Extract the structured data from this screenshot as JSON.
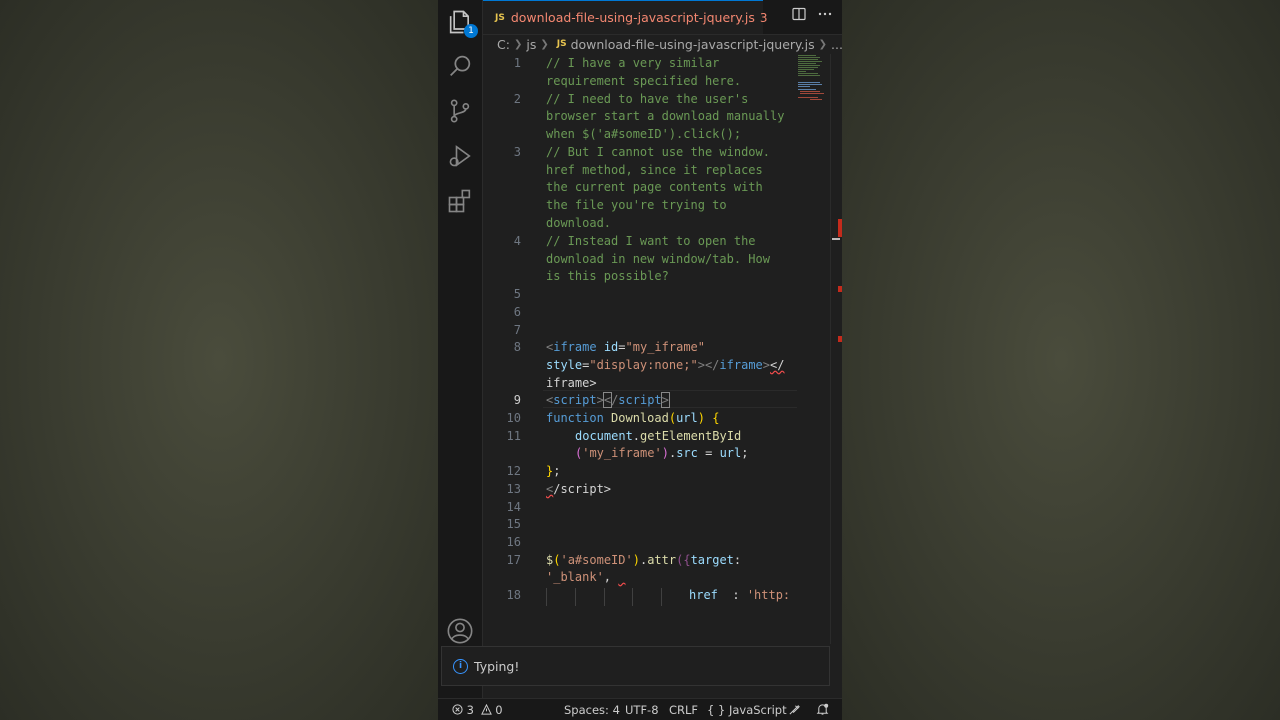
{
  "tab": {
    "lang_tag": "JS",
    "title": "download-file-using-javascript-jquery.js",
    "problems": "3",
    "split_icon": "split-editor-icon",
    "more_icon": "more-actions-icon"
  },
  "breadcrumb": {
    "drive": "C:",
    "folder": "js",
    "lang_tag": "JS",
    "file": "download-file-using-javascript-jquery.js",
    "more": "..."
  },
  "activity": {
    "explorer_badge": "1"
  },
  "editor": {
    "lines": [
      {
        "n": "1"
      },
      {
        "n": "2"
      },
      {
        "n": "3"
      },
      {
        "n": "4"
      },
      {
        "n": "5"
      },
      {
        "n": "6"
      },
      {
        "n": "7"
      },
      {
        "n": "8"
      },
      {
        "n": "9"
      },
      {
        "n": "10"
      },
      {
        "n": "11"
      },
      {
        "n": "12"
      },
      {
        "n": "13"
      },
      {
        "n": "14"
      },
      {
        "n": "15"
      },
      {
        "n": "16"
      },
      {
        "n": "17"
      },
      {
        "n": "18"
      }
    ],
    "code": {
      "l1a": "// I have a very similar",
      "l1b": "requirement specified here.",
      "l2a": "// I need to have the user's",
      "l2b": "browser start a download manually",
      "l2c": "when $('a#someID').click();",
      "l3a": "// But I cannot use the window.",
      "l3b": "href method, since it replaces",
      "l3c": "the current page contents with",
      "l3d": "the file you're trying to",
      "l3e": "download.",
      "l4a": "// Instead I want to open the",
      "l4b": "download in new window/tab. How",
      "l4c": "is this possible?",
      "l8_open": "<",
      "l8_tag": "iframe",
      "l8_id_attr": "id",
      "l8_eq1": "=",
      "l8_id_val": "\"my_iframe\"",
      "l8_style_attr": "style",
      "l8_eq2": "=",
      "l8_style_val": "\"display:none;\"",
      "l8_close1": "></",
      "l8_ctag": "iframe",
      "l8_close2": ">",
      "l8_err": "</",
      "l8_tail": "iframe>",
      "l9_open": "<",
      "l9_tag": "script",
      "l9_gt": ">",
      "l9_match": "<",
      "l9_slash": "/",
      "l9_ctag": "script",
      "l9_end": ">",
      "l10_kw": "function",
      "l10_fn": "Download",
      "l10_p1": "(",
      "l10_param": "url",
      "l10_p2": ")",
      "l10_brace": "{",
      "l11_obj": "document",
      "l11_dot": ".",
      "l11_fn": "getElementById",
      "l11_p1": "(",
      "l11_str": "'my_iframe'",
      "l11_p2": ")",
      "l11_dot2": ".",
      "l11_prop": "src",
      "l11_eq": " = ",
      "l11_var": "url",
      "l11_semi": ";",
      "l12_brace": "}",
      "l12_semi": ";",
      "l13_err": "<",
      "l13_rest": "/script>",
      "l17_fn": "$",
      "l17_p1": "(",
      "l17_str": "'a#someID'",
      "l17_p2": ")",
      "l17_dot": ".",
      "l17_method": "attr",
      "l17_p3": "(",
      "l17_brace": "{",
      "l17_key": "target",
      "l17_colon": ":",
      "l17_val": "'_blank'",
      "l17_comma": ",",
      "l17_squig": " ",
      "l18_key": "href",
      "l18_colon": "  : ",
      "l18_val": "'http:"
    }
  },
  "notification": {
    "icon": "info-icon",
    "text": "Typing!"
  },
  "status": {
    "errors": "3",
    "warnings": "0",
    "spaces": "Spaces: 4",
    "encoding": "UTF-8",
    "eol": "CRLF",
    "lang_braces": "{ }",
    "language": "JavaScript"
  }
}
